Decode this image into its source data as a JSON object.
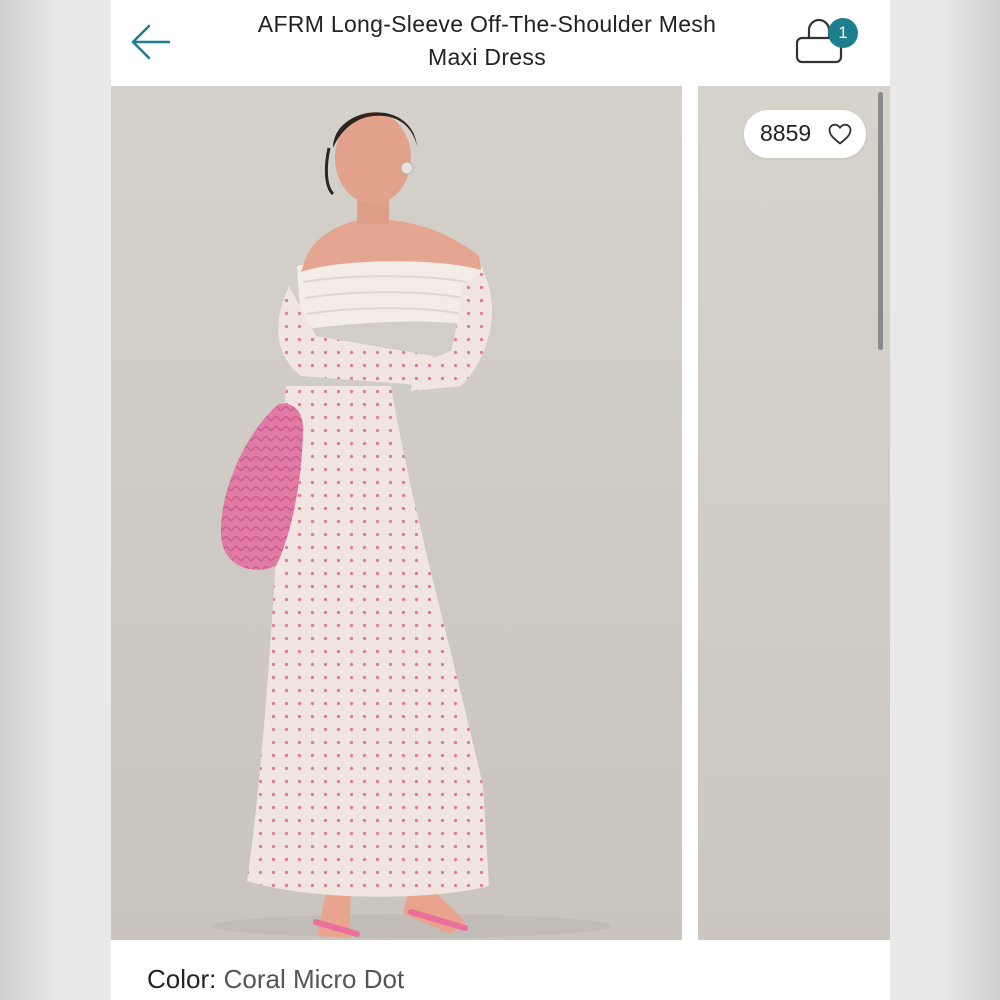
{
  "header": {
    "title_line1": "AFRM Long-Sleeve Off-The-Shoulder Mesh",
    "title_line2": "Maxi Dress",
    "back_icon": "arrow-left-icon",
    "cart_icon": "shopping-bag-icon",
    "cart_count": "1"
  },
  "gallery": {
    "likes_count": "8859",
    "likes_icon": "heart-outline-icon"
  },
  "product": {
    "color_label": "Color:",
    "color_value": "Coral Micro Dot"
  },
  "colors": {
    "accent": "#1d7f8e",
    "dress": "#f0e6df",
    "dot": "#e6779a",
    "bag": "#e27aa6"
  }
}
